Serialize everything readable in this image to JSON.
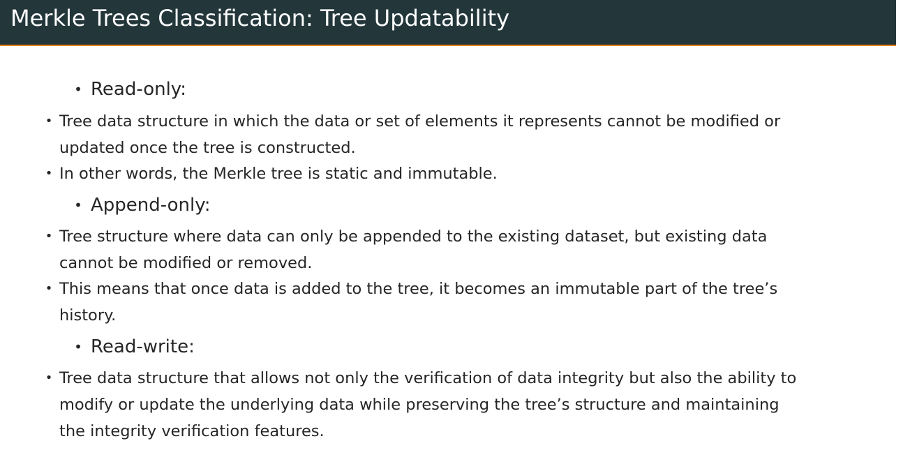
{
  "slide": {
    "title": "Merkle Trees Classification: Tree Updatability",
    "bullet_glyph": "•",
    "colors": {
      "title_bar": "#23373b",
      "accent": "#eb811b",
      "text": "#262626"
    }
  },
  "sections": [
    {
      "label": "Read-only:",
      "items": [
        "Tree data structure in which the data or set of elements it represents cannot be modified or updated once the tree is constructed.",
        "In other words, the Merkle tree is static and immutable."
      ]
    },
    {
      "label": "Append-only:",
      "items": [
        "Tree structure where data can only be appended to the existing dataset, but existing data cannot be modified or removed.",
        "This means that once data is added to the tree, it becomes an immutable part of the tree’s history."
      ]
    },
    {
      "label": "Read-write:",
      "items": [
        "Tree data structure that allows not only the verification of data integrity but also the ability to modify or update the underlying data while preserving the tree’s structure and maintaining the integrity verification features."
      ]
    }
  ]
}
